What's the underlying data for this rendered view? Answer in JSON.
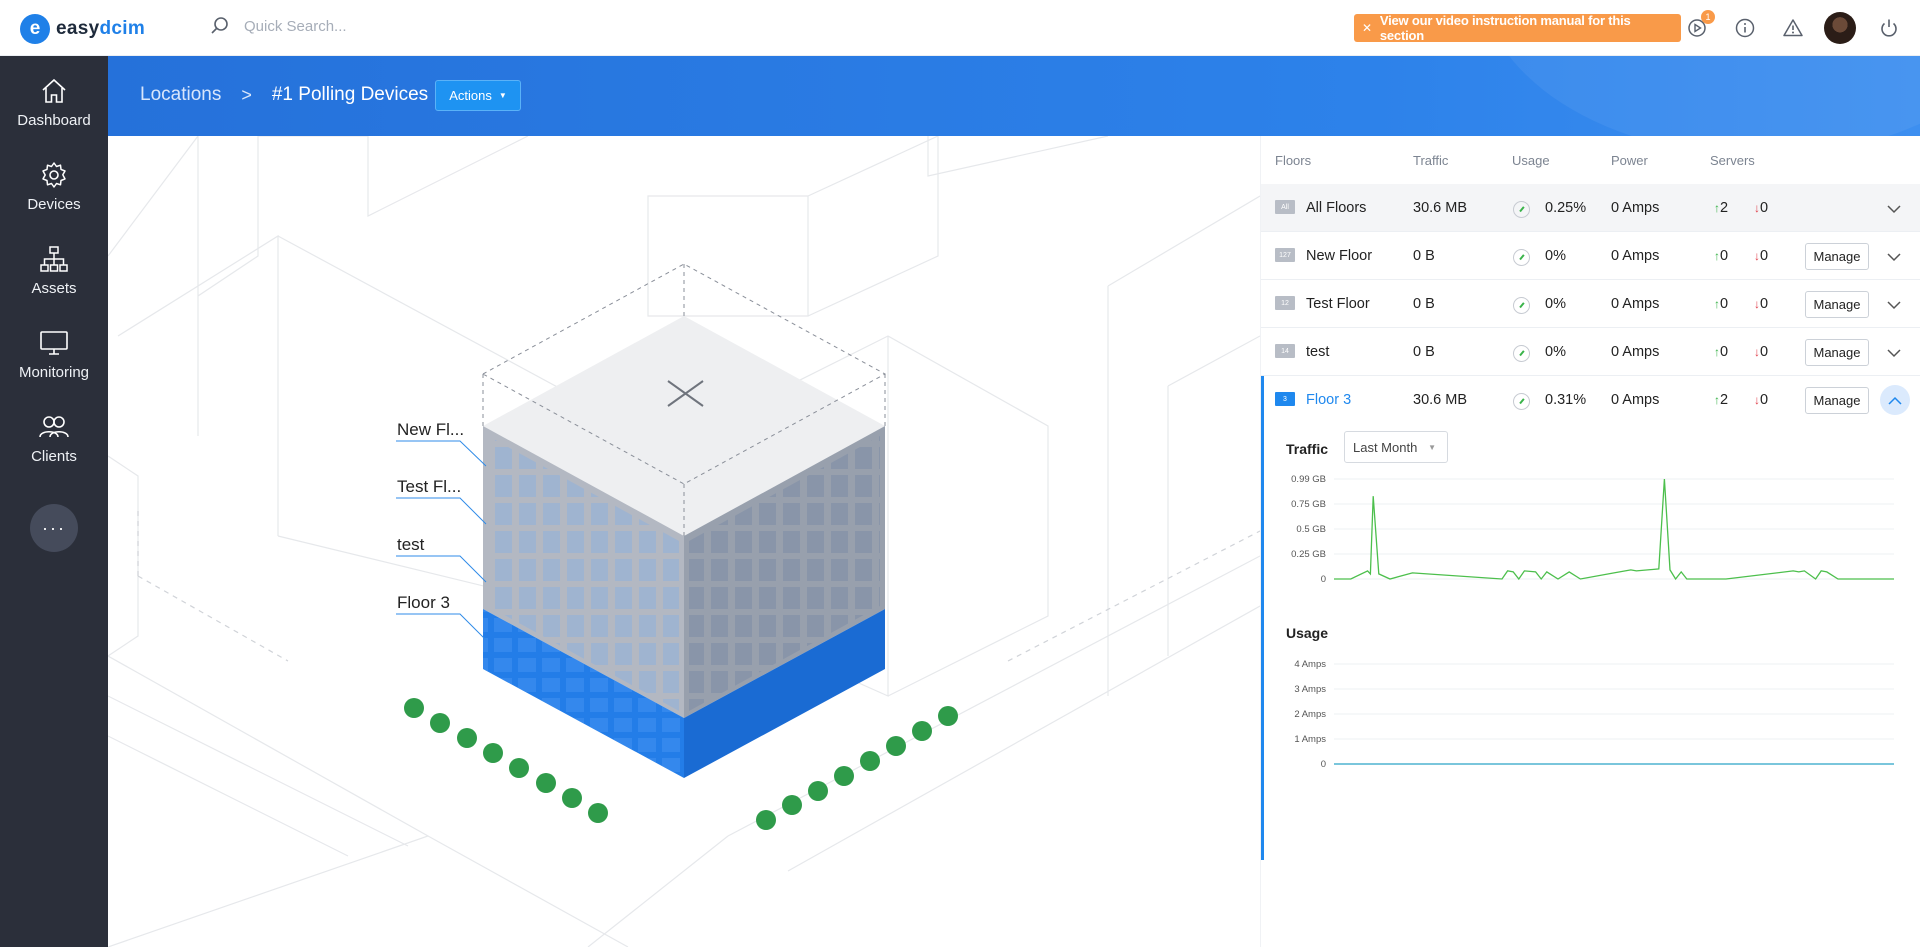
{
  "app": {
    "brand_letter": "e",
    "brand_name_a": "easy",
    "brand_name_b": "dcim"
  },
  "search": {
    "placeholder": "Quick Search..."
  },
  "banner": {
    "text": "View our video instruction manual for this section"
  },
  "notifications": {
    "count": "1"
  },
  "sidebar": {
    "items": [
      {
        "label": "Dashboard",
        "icon": "home-icon"
      },
      {
        "label": "Devices",
        "icon": "gear-icon"
      },
      {
        "label": "Assets",
        "icon": "sitemap-icon"
      },
      {
        "label": "Monitoring",
        "icon": "monitor-icon"
      },
      {
        "label": "Clients",
        "icon": "users-icon"
      }
    ],
    "more": "···"
  },
  "breadcrumb": {
    "parent": "Locations",
    "current": "#1 Polling Devices"
  },
  "actions_label": "Actions",
  "building": {
    "floor_labels": [
      "New Fl...",
      "Test Fl...",
      "test",
      "Floor 3"
    ]
  },
  "floors_table": {
    "headers": {
      "floors": "Floors",
      "traffic": "Traffic",
      "usage": "Usage",
      "power": "Power",
      "servers": "Servers"
    },
    "rows": [
      {
        "tag": "All",
        "name": "All Floors",
        "traffic": "30.6 MB",
        "usage": "0.25%",
        "power": "0 Amps",
        "up": "2",
        "down": "0",
        "manage": ""
      },
      {
        "tag": "127",
        "name": "New Floor",
        "traffic": "0 B",
        "usage": "0%",
        "power": "0 Amps",
        "up": "0",
        "down": "0",
        "manage": "Manage"
      },
      {
        "tag": "12",
        "name": "Test Floor",
        "traffic": "0 B",
        "usage": "0%",
        "power": "0 Amps",
        "up": "0",
        "down": "0",
        "manage": "Manage"
      },
      {
        "tag": "14",
        "name": "test",
        "traffic": "0 B",
        "usage": "0%",
        "power": "0 Amps",
        "up": "0",
        "down": "0",
        "manage": "Manage"
      },
      {
        "tag": "3",
        "name": "Floor 3",
        "traffic": "30.6 MB",
        "usage": "0.31%",
        "power": "0 Amps",
        "up": "2",
        "down": "0",
        "manage": "Manage"
      }
    ]
  },
  "detail": {
    "traffic_title": "Traffic",
    "period": "Last Month",
    "usage_title": "Usage",
    "colors": {
      "traffic_line": "#4cbf4c",
      "usage_line": "#2aa3c8",
      "accent": "#1f88ee"
    }
  },
  "chart_data": [
    {
      "type": "line",
      "title": "Traffic",
      "y_ticks": [
        "0.99 GB",
        "0.75 GB",
        "0.5 GB",
        "0.25 GB",
        "0"
      ],
      "ylim": [
        0,
        0.99
      ],
      "x": [
        0,
        3,
        6,
        6.5,
        7,
        8,
        10,
        14,
        30,
        31,
        32,
        33,
        34,
        36,
        37,
        38,
        40,
        42,
        44,
        50,
        53,
        54,
        58,
        59,
        60,
        61,
        62,
        63,
        64,
        65,
        70,
        82,
        83,
        84,
        86,
        87,
        88,
        90,
        100
      ],
      "series": [
        {
          "name": "",
          "values": [
            0,
            0,
            0.08,
            0.05,
            0.82,
            0.05,
            0,
            0.06,
            0,
            0.08,
            0.07,
            0,
            0.08,
            0.07,
            0,
            0.07,
            0,
            0.07,
            0,
            0.06,
            0.09,
            0.08,
            0.1,
            0.99,
            0.09,
            0,
            0.07,
            0,
            0,
            0,
            0,
            0.08,
            0.07,
            0.08,
            0,
            0.08,
            0.07,
            0,
            0
          ]
        }
      ]
    },
    {
      "type": "line",
      "title": "Usage",
      "y_ticks": [
        "4 Amps",
        "3 Amps",
        "2 Amps",
        "1 Amps",
        "0"
      ],
      "ylim": [
        0,
        4
      ],
      "x": [
        0,
        100
      ],
      "series": [
        {
          "name": "",
          "values": [
            0,
            0
          ]
        }
      ]
    }
  ]
}
